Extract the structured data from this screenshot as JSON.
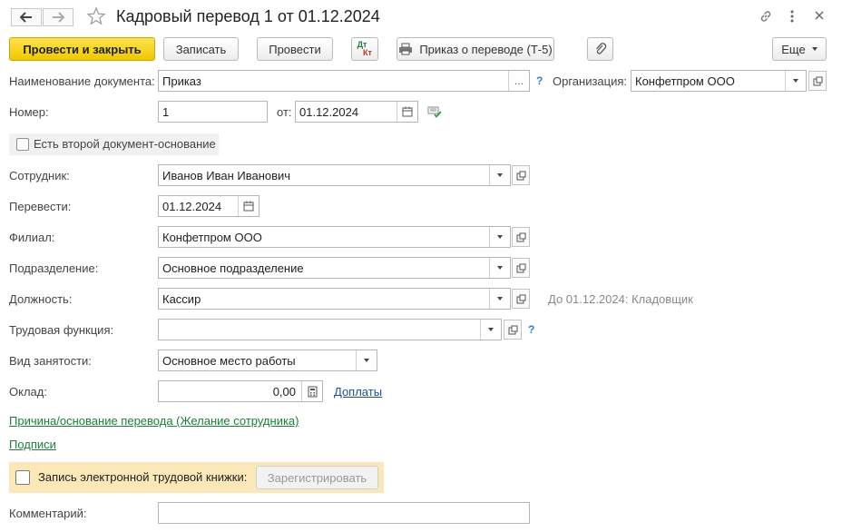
{
  "window": {
    "title": "Кадровый перевод 1 от 01.12.2024"
  },
  "toolbar": {
    "post_close_label": "Провести и закрыть",
    "save_label": "Записать",
    "post_label": "Провести",
    "dtkt_top": "Дт",
    "dtkt_bottom": "Кт",
    "print_label": "Приказ о переводе (Т-5)",
    "more_label": "Еще"
  },
  "form": {
    "doc_name_label": "Наименование документа:",
    "doc_name_value": "Приказ",
    "ellipsis": "...",
    "help": "?",
    "org_label": "Организация:",
    "org_value": "Конфетпром ООО",
    "number_label": "Номер:",
    "number_value": "1",
    "from_label": "от:",
    "date_value": "01.12.2024",
    "second_doc_label": "Есть второй документ-основание",
    "employee_label": "Сотрудник:",
    "employee_value": "Иванов Иван Иванович",
    "transfer_label": "Перевести:",
    "transfer_date": "01.12.2024",
    "branch_label": "Филиал:",
    "branch_value": "Конфетпром ООО",
    "dept_label": "Подразделение:",
    "dept_value": "Основное подразделение",
    "position_label": "Должность:",
    "position_value": "Кассир",
    "position_hint": "До 01.12.2024: Кладовщик",
    "labor_func_label": "Трудовая функция:",
    "labor_func_value": "",
    "employment_label": "Вид занятости:",
    "employment_value": "Основное место работы",
    "salary_label": "Оклад:",
    "salary_value": "0,00",
    "allowances_link": "Доплаты",
    "reason_link": "Причина/основание перевода (Желание сотрудника)",
    "signatures_link": "Подписи",
    "etk_label": "Запись электронной трудовой книжки:",
    "register_label": "Зарегистрировать",
    "comment_label": "Комментарий:",
    "comment_value": ""
  },
  "colors": {
    "primary_button": "#f5d31c",
    "link_green": "#1a7f3a",
    "link_blue": "#1e4fa6",
    "etk_highlight": "#fbe7b8"
  }
}
